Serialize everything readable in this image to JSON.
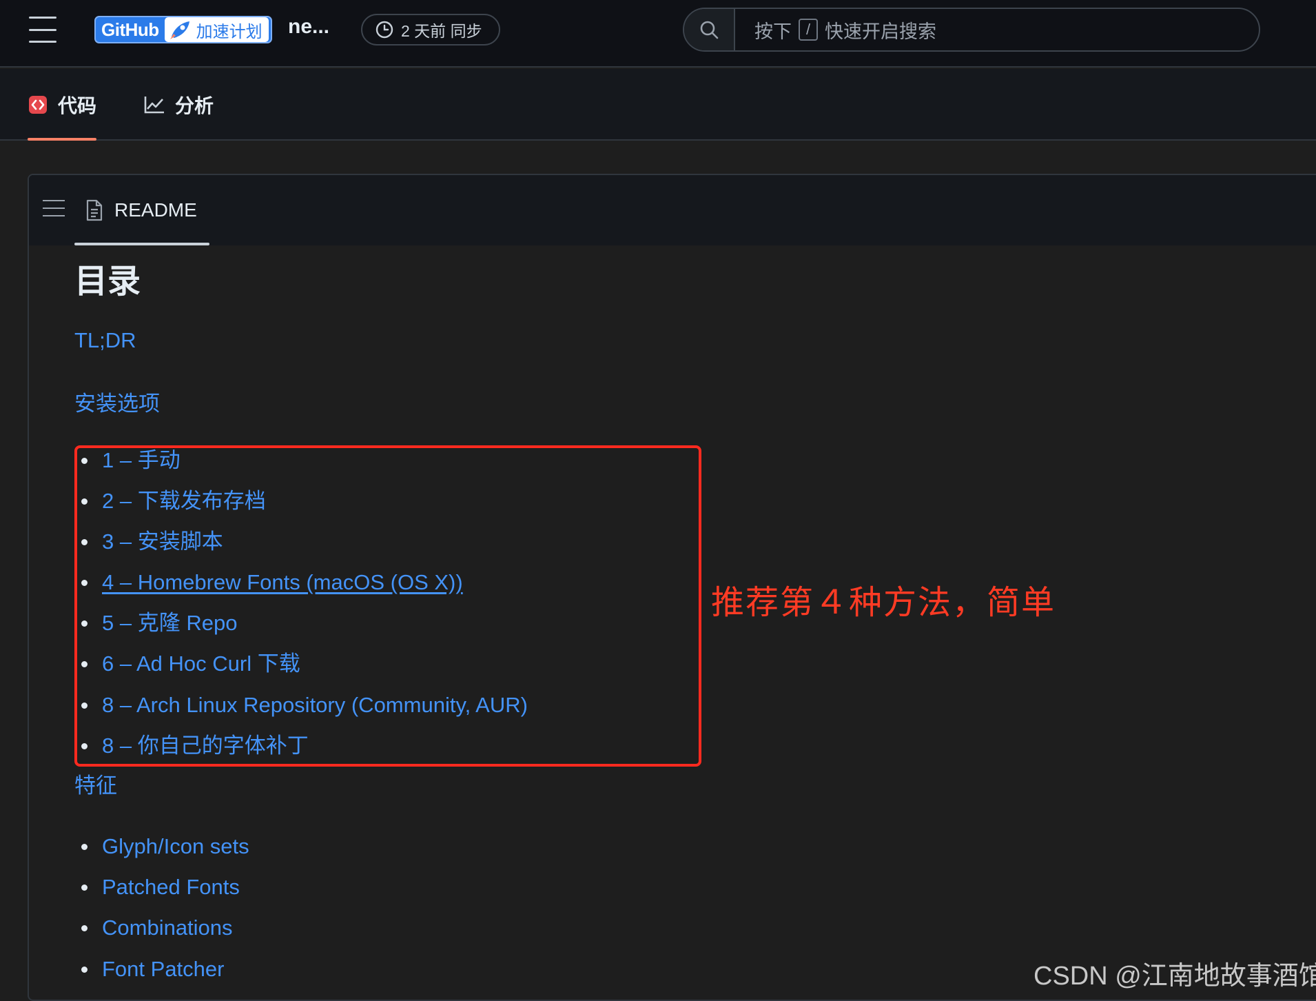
{
  "header": {
    "logo_brand": "GitHub",
    "logo_tag": "加速计划",
    "repo_name": "ne...",
    "sync_status": "2 天前 同步",
    "search": {
      "prefix": "按下",
      "key": "/",
      "suffix": "快速开启搜索"
    }
  },
  "tabs": [
    {
      "label": "代码",
      "icon": "code-icon",
      "active": true
    },
    {
      "label": "分析",
      "icon": "graph-icon",
      "active": false
    }
  ],
  "readme": {
    "tab_label": "README",
    "toc_title": "目录",
    "links": {
      "tldr": "TL;DR",
      "install_options": "安装选项",
      "features": "特征"
    },
    "install_items": [
      "1 – 手动",
      "2 – 下载发布存档",
      "3 – 安装脚本",
      "4 – Homebrew Fonts (macOS (OS X))",
      "5 – 克隆 Repo",
      "6 – Ad Hoc Curl 下载",
      "8 – Arch Linux Repository (Community, AUR)",
      "8 – 你自己的字体补丁"
    ],
    "feature_items": [
      "Glyph/Icon sets",
      "Patched Fonts",
      "Combinations",
      "Font Patcher"
    ]
  },
  "annotation": "推荐第４种方法，简单",
  "watermark": "CSDN @江南地故事酒馆",
  "colors": {
    "link": "#4493f8",
    "annotation_red": "#ff2a1f",
    "background": "#1e1e1e",
    "topbar": "#0f1116"
  }
}
